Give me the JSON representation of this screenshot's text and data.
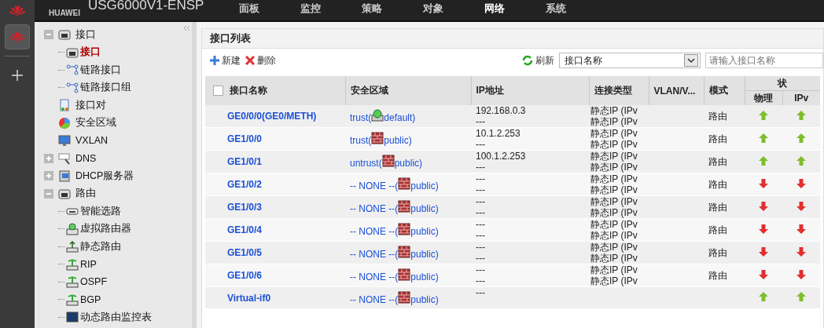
{
  "header": {
    "brand": "HUAWEI",
    "title": "USG6000V1-ENSP",
    "nav": [
      {
        "label": "面板",
        "selected": false
      },
      {
        "label": "监控",
        "selected": false
      },
      {
        "label": "策略",
        "selected": false
      },
      {
        "label": "对象",
        "selected": false
      },
      {
        "label": "网络",
        "selected": true
      },
      {
        "label": "系统",
        "selected": false
      }
    ]
  },
  "sidebar": {
    "items": [
      {
        "label": "接口",
        "kind": "port",
        "expanded": true,
        "selected": false,
        "children": [
          {
            "label": "接口",
            "kind": "port",
            "selected": true
          },
          {
            "label": "链路接口",
            "kind": "link",
            "selected": false
          },
          {
            "label": "链路接口组",
            "kind": "link",
            "selected": false
          }
        ]
      },
      {
        "label": "接口对",
        "kind": "pair",
        "selected": false
      },
      {
        "label": "安全区域",
        "kind": "zone",
        "selected": false
      },
      {
        "label": "VXLAN",
        "kind": "monitor",
        "selected": false
      },
      {
        "label": "DNS",
        "kind": "dns",
        "expanded": false,
        "selected": false
      },
      {
        "label": "DHCP服务器",
        "kind": "server",
        "expanded": false,
        "selected": false
      },
      {
        "label": "路由",
        "kind": "router",
        "expanded": true,
        "selected": false,
        "children": [
          {
            "label": "智能选路",
            "kind": "router",
            "selected": false
          },
          {
            "label": "虚拟路由器",
            "kind": "vrouter",
            "selected": false
          },
          {
            "label": "静态路由",
            "kind": "static",
            "selected": false
          },
          {
            "label": "RIP",
            "kind": "proto",
            "selected": false
          },
          {
            "label": "OSPF",
            "kind": "proto",
            "selected": false
          },
          {
            "label": "BGP",
            "kind": "proto",
            "selected": false
          },
          {
            "label": "动态路由监控表",
            "kind": "monitor",
            "selected": false
          }
        ]
      }
    ]
  },
  "panel": {
    "title": "接口列表",
    "toolbar": {
      "new": "新建",
      "delete": "删除",
      "refresh": "刷新",
      "filter_select": "接口名称",
      "search": {
        "placeholder": "请输入接口名称"
      }
    },
    "table": {
      "columns": [
        "接口名称",
        "安全区域",
        "IP地址",
        "连接类型",
        "VLAN/V...",
        "模式"
      ],
      "status_header": "状",
      "select_all": {
        "checked": false
      },
      "status_columns": [
        "物理",
        "IPv"
      ],
      "rows": [
        {
          "kind": "vsys",
          "name": "GE0/0/0(GE0/METH)",
          "zone": "trust(",
          "vsys": "default)",
          "ip": [
            "192.168.0.3",
            "---"
          ],
          "connection": [
            "静态IP (IPv",
            "静态IP (IPv"
          ],
          "mode": "路由",
          "physical_up": true,
          "ipv_up": true
        },
        {
          "kind": "brick",
          "name": "GE1/0/0",
          "zone": "trust(",
          "vsys": "public)",
          "ip": [
            "10.1.2.253",
            "---"
          ],
          "connection": [
            "静态IP (IPv",
            "静态IP (IPv"
          ],
          "mode": "路由",
          "physical_up": true,
          "ipv_up": true
        },
        {
          "kind": "brick",
          "name": "GE1/0/1",
          "zone": "untrust(",
          "vsys": "public)",
          "ip": [
            "100.1.2.253",
            "---"
          ],
          "connection": [
            "静态IP (IPv",
            "静态IP (IPv"
          ],
          "mode": "路由",
          "physical_up": true,
          "ipv_up": true
        },
        {
          "kind": "brick",
          "name": "GE1/0/2",
          "zone": "-- NONE --(",
          "vsys": "public)",
          "ip": [
            "---",
            "---"
          ],
          "connection": [
            "静态IP (IPv",
            "静态IP (IPv"
          ],
          "mode": "路由",
          "physical_up": false,
          "ipv_up": false
        },
        {
          "kind": "brick",
          "name": "GE1/0/3",
          "zone": "-- NONE --(",
          "vsys": "public)",
          "ip": [
            "---",
            "---"
          ],
          "connection": [
            "静态IP (IPv",
            "静态IP (IPv"
          ],
          "mode": "路由",
          "physical_up": false,
          "ipv_up": false
        },
        {
          "kind": "brick",
          "name": "GE1/0/4",
          "zone": "-- NONE --(",
          "vsys": "public)",
          "ip": [
            "---",
            "---"
          ],
          "connection": [
            "静态IP (IPv",
            "静态IP (IPv"
          ],
          "mode": "路由",
          "physical_up": false,
          "ipv_up": false
        },
        {
          "kind": "brick",
          "name": "GE1/0/5",
          "zone": "-- NONE --(",
          "vsys": "public)",
          "ip": [
            "---",
            "---"
          ],
          "connection": [
            "静态IP (IPv",
            "静态IP (IPv"
          ],
          "mode": "路由",
          "physical_up": false,
          "ipv_up": false
        },
        {
          "kind": "brick",
          "name": "GE1/0/6",
          "zone": "-- NONE --(",
          "vsys": "public)",
          "ip": [
            "---",
            "---"
          ],
          "connection": [
            "静态IP (IPv",
            "静态IP (IPv"
          ],
          "mode": "路由",
          "physical_up": false,
          "ipv_up": false
        },
        {
          "kind": "brick",
          "name": "Virtual-if0",
          "zone": "-- NONE --(",
          "vsys": "public)",
          "ip": [
            "---"
          ],
          "connection": [],
          "mode": "",
          "physical_up": true,
          "ipv_up": true
        }
      ]
    }
  }
}
